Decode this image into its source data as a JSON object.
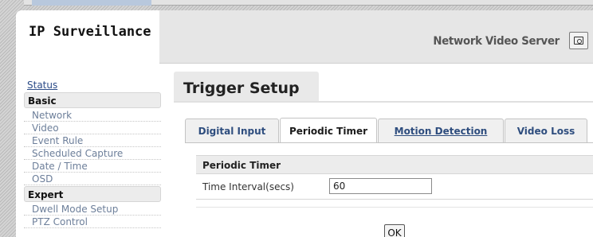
{
  "header": {
    "app_title": "IP Surveillance",
    "product_name": "Network Video Server"
  },
  "sidebar": {
    "status_link": "Status",
    "basic": {
      "label": "Basic",
      "items": [
        "Network",
        "Video",
        "Event Rule",
        "Scheduled Capture",
        "Date / Time",
        "OSD"
      ]
    },
    "expert": {
      "label": "Expert",
      "items": [
        "Dwell Mode Setup",
        "PTZ Control"
      ]
    }
  },
  "main": {
    "page_title": "Trigger Setup",
    "tabs": [
      {
        "label": "Digital Input",
        "active": false
      },
      {
        "label": "Periodic Timer",
        "active": true
      },
      {
        "label": "Motion Detection",
        "active": false
      },
      {
        "label": "Video Loss",
        "active": false
      }
    ],
    "panel": {
      "title": "Periodic Timer",
      "time_interval_label": "Time Interval(secs)",
      "time_interval_value": "60"
    },
    "ok_label": "OK"
  },
  "icons": {
    "language_button": "language-icon"
  },
  "colors": {
    "link": "#2c4c88",
    "sidebar_item": "#6d7f9a",
    "tab_text": "#2e4d7e",
    "header_bg": "#e6e6e6"
  }
}
